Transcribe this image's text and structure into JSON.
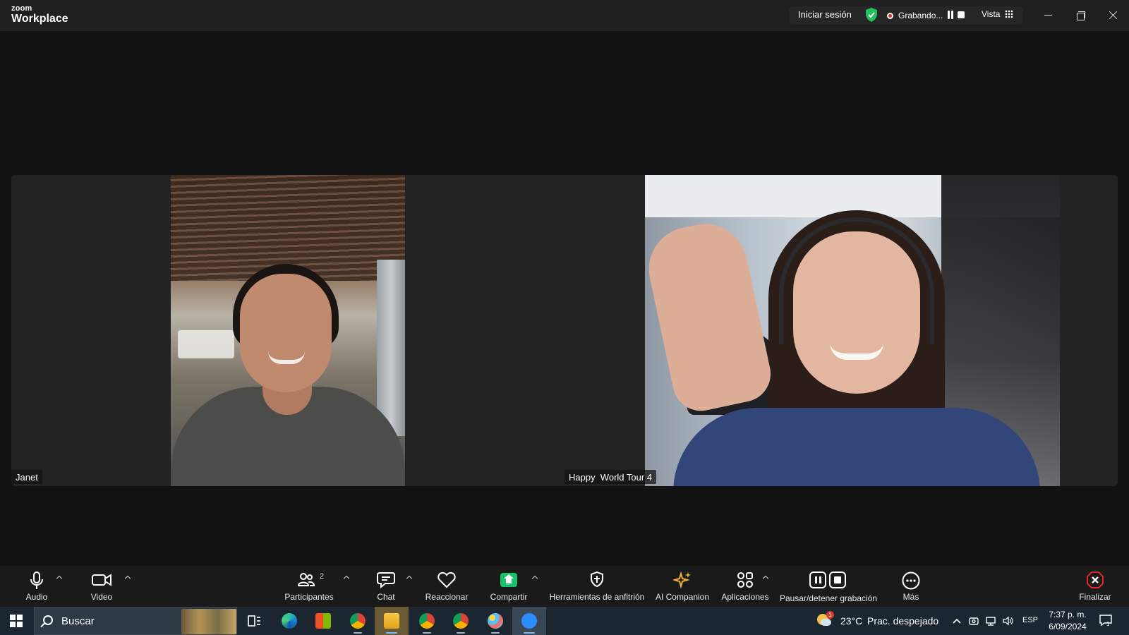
{
  "app": {
    "brand_small": "zoom",
    "brand_large": "Workplace"
  },
  "header": {
    "signin_label": "Iniciar sesión",
    "recording_label": "Grabando...",
    "view_label": "Vista"
  },
  "participants": [
    {
      "name": "Janet"
    },
    {
      "name": "Happy  World Tour 4"
    }
  ],
  "toolbar": {
    "audio": "Audio",
    "video": "Video",
    "participants": "Participantes",
    "participants_count": "2",
    "chat": "Chat",
    "react": "Reaccionar",
    "share": "Compartir",
    "host_tools": "Herramientas de anfitrión",
    "ai_companion": "AI Companion",
    "apps": "Aplicaciones",
    "pause_stop_recording": "Pausar/detener grabación",
    "more": "Más",
    "end": "Finalizar"
  },
  "taskbar": {
    "search_placeholder": "Buscar",
    "weather_badge": "1",
    "temperature": "23°C",
    "condition": "Prac. despejado",
    "language": "ESP",
    "time": "7:37 p. m.",
    "date": "6/09/2024",
    "notification_count": "1"
  },
  "colors": {
    "accent_share": "#19c36a",
    "shield": "#20c05c",
    "recording": "#e02828",
    "end_button": "#e02828"
  }
}
